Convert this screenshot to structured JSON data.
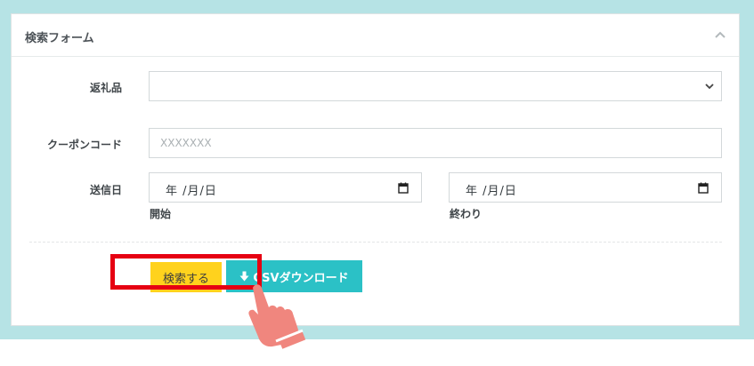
{
  "panel": {
    "title": "検索フォーム"
  },
  "form": {
    "gift_label": "返礼品",
    "gift_selected": "",
    "coupon_label": "クーポンコード",
    "coupon_placeholder": "XXXXXXX",
    "sent_date_label": "送信日",
    "start_date_text": "年 /月/日",
    "start_caption": "開始",
    "end_date_text": "年 /月/日",
    "end_caption": "終わり"
  },
  "actions": {
    "search_label": "検索する",
    "csv_label": "CSVダウンロード"
  },
  "colors": {
    "frame": "#b6e3e5",
    "search_button": "#ffd21d",
    "csv_button": "#2bc1c6",
    "highlight": "#e60012",
    "pointer": "#f0867e"
  },
  "icons": {
    "collapse": "chevron-up-icon",
    "select": "chevron-down-icon",
    "calendar": "calendar-icon",
    "download": "arrow-down-icon",
    "pointer": "pointing-hand-icon"
  }
}
